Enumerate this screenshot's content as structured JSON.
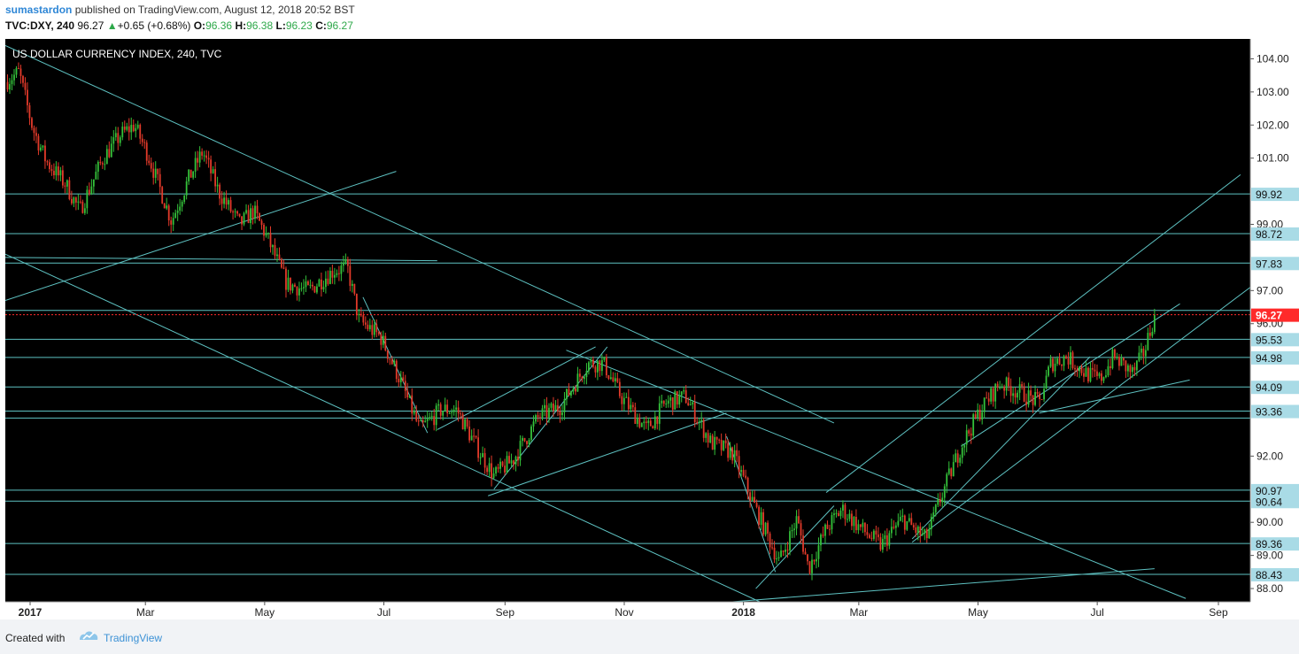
{
  "header": {
    "author": "sumastardon",
    "published_text": " published on TradingView.com, August 12, 2018 20:52 BST",
    "symbol": "TVC:DXY, 240",
    "last": "96.27",
    "change": "+0.65 (+0.68%)",
    "o_label": "O:",
    "o_value": "96.36",
    "h_label": "H:",
    "h_value": "96.38",
    "l_label": "L:",
    "l_value": "96.23",
    "c_label": "C:",
    "c_value": "96.27"
  },
  "footer": {
    "created_with": "Created with",
    "brand": "TradingView"
  },
  "colors": {
    "background": "#000000",
    "line": "#5ec2c2",
    "bull": "#34c13a",
    "bear": "#e23a2a",
    "price_marker": "#ff2a2a",
    "label_fill": "#a9dbe6"
  },
  "chart_data": {
    "type": "candlestick",
    "title": "US DOLLAR CURRENCY INDEX, 240, TVC",
    "ylim": [
      87.6,
      104.6
    ],
    "y_ticks": [
      "104.00",
      "103.00",
      "102.00",
      "101.00",
      "99.00",
      "97.00",
      "96.00",
      "92.00",
      "90.00",
      "89.00",
      "88.00"
    ],
    "x_ticks": [
      "2017",
      "Mar",
      "May",
      "Jul",
      "Sep",
      "Nov",
      "2018",
      "Mar",
      "May",
      "Jul",
      "Sep"
    ],
    "x_range": [
      "2017-01-01",
      "2018-09-30"
    ],
    "last_price": "96.27",
    "level_labels": [
      "99.92",
      "98.72",
      "97.83",
      "95.53",
      "94.98",
      "94.09",
      "93.36",
      "90.97",
      "90.64",
      "89.36",
      "88.43"
    ],
    "level_values": [
      99.92,
      98.72,
      97.83,
      96.4,
      95.53,
      94.98,
      94.09,
      93.36,
      93.15,
      90.97,
      90.64,
      89.36,
      88.43
    ],
    "price_path": [
      [
        "2017-01-01",
        103.3
      ],
      [
        "2017-01-08",
        103.6
      ],
      [
        "2017-01-15",
        101.9
      ],
      [
        "2017-01-22",
        100.9
      ],
      [
        "2017-02-01",
        100.2
      ],
      [
        "2017-02-08",
        99.4
      ],
      [
        "2017-02-20",
        101.0
      ],
      [
        "2017-03-01",
        101.7
      ],
      [
        "2017-03-08",
        102.0
      ],
      [
        "2017-03-15",
        101.1
      ],
      [
        "2017-03-27",
        99.1
      ],
      [
        "2017-04-05",
        100.4
      ],
      [
        "2017-04-12",
        101.2
      ],
      [
        "2017-04-20",
        100.0
      ],
      [
        "2017-05-01",
        99.0
      ],
      [
        "2017-05-08",
        99.4
      ],
      [
        "2017-05-15",
        98.6
      ],
      [
        "2017-05-25",
        97.2
      ],
      [
        "2017-06-05",
        97.0
      ],
      [
        "2017-06-18",
        97.6
      ],
      [
        "2017-06-25",
        97.7
      ],
      [
        "2017-07-01",
        96.1
      ],
      [
        "2017-07-12",
        95.6
      ],
      [
        "2017-07-22",
        94.3
      ],
      [
        "2017-08-01",
        92.8
      ],
      [
        "2017-08-12",
        93.4
      ],
      [
        "2017-08-20",
        93.4
      ],
      [
        "2017-08-28",
        92.5
      ],
      [
        "2017-09-08",
        91.4
      ],
      [
        "2017-09-18",
        91.9
      ],
      [
        "2017-10-01",
        93.2
      ],
      [
        "2017-10-12",
        93.5
      ],
      [
        "2017-10-26",
        94.8
      ],
      [
        "2017-11-03",
        94.8
      ],
      [
        "2017-11-12",
        93.8
      ],
      [
        "2017-11-25",
        92.8
      ],
      [
        "2017-12-05",
        93.6
      ],
      [
        "2017-12-15",
        93.8
      ],
      [
        "2017-12-28",
        92.4
      ],
      [
        "2018-01-08",
        92.1
      ],
      [
        "2018-01-20",
        90.4
      ],
      [
        "2018-02-01",
        88.8
      ],
      [
        "2018-02-10",
        90.1
      ],
      [
        "2018-02-16",
        88.6
      ],
      [
        "2018-02-25",
        89.8
      ],
      [
        "2018-03-05",
        90.4
      ],
      [
        "2018-03-15",
        89.8
      ],
      [
        "2018-03-25",
        89.3
      ],
      [
        "2018-04-05",
        90.1
      ],
      [
        "2018-04-17",
        89.5
      ],
      [
        "2018-04-25",
        90.8
      ],
      [
        "2018-05-05",
        92.3
      ],
      [
        "2018-05-15",
        93.4
      ],
      [
        "2018-05-25",
        94.2
      ],
      [
        "2018-06-05",
        93.9
      ],
      [
        "2018-06-14",
        93.6
      ],
      [
        "2018-06-20",
        94.8
      ],
      [
        "2018-06-28",
        95.0
      ],
      [
        "2018-07-08",
        94.5
      ],
      [
        "2018-07-15",
        94.3
      ],
      [
        "2018-07-22",
        95.0
      ],
      [
        "2018-08-01",
        94.5
      ],
      [
        "2018-08-07",
        95.2
      ],
      [
        "2018-08-12",
        96.27
      ]
    ],
    "trend_lines": [
      [
        [
          "2017-01-01",
          104.4
        ],
        [
          "2018-03-01",
          93.0
        ]
      ],
      [
        [
          "2017-01-01",
          98.0
        ],
        [
          "2017-08-10",
          97.9
        ]
      ],
      [
        [
          "2017-01-01",
          96.7
        ],
        [
          "2017-07-20",
          100.6
        ]
      ],
      [
        [
          "2017-01-01",
          98.1
        ],
        [
          "2018-01-22",
          87.6
        ]
      ],
      [
        [
          "2017-09-08",
          91.0
        ],
        [
          "2017-11-05",
          95.3
        ]
      ],
      [
        [
          "2017-08-10",
          92.8
        ],
        [
          "2017-10-30",
          95.3
        ]
      ],
      [
        [
          "2017-09-05",
          90.8
        ],
        [
          "2018-01-05",
          93.3
        ]
      ],
      [
        [
          "2018-01-20",
          88.0
        ],
        [
          "2018-03-01",
          90.5
        ]
      ],
      [
        [
          "2018-02-25",
          90.9
        ],
        [
          "2018-09-25",
          100.5
        ]
      ],
      [
        [
          "2018-04-10",
          89.4
        ],
        [
          "2018-09-30",
          97.1
        ]
      ],
      [
        [
          "2018-06-14",
          93.3
        ],
        [
          "2018-08-30",
          94.3
        ]
      ],
      [
        [
          "2018-04-10",
          89.5
        ],
        [
          "2018-07-10",
          95.0
        ]
      ],
      [
        [
          "2018-05-05",
          92.3
        ],
        [
          "2018-08-25",
          96.6
        ]
      ],
      [
        [
          "2017-10-15",
          95.2
        ],
        [
          "2018-08-28",
          87.7
        ]
      ],
      [
        [
          "2018-01-08",
          87.6
        ],
        [
          "2018-08-12",
          88.6
        ]
      ],
      [
        [
          "2017-07-03",
          96.8
        ],
        [
          "2017-08-05",
          92.7
        ]
      ],
      [
        [
          "2018-01-05",
          92.6
        ],
        [
          "2018-01-30",
          88.5
        ]
      ]
    ]
  }
}
